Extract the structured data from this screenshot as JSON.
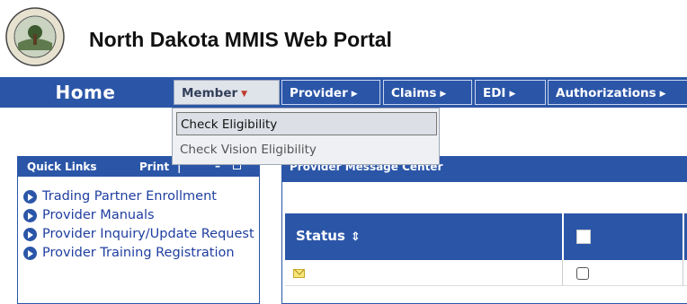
{
  "header": {
    "title": "North Dakota MMIS Web Portal"
  },
  "nav": {
    "home": "Home",
    "items": [
      {
        "label": "Member",
        "arrow": "▼",
        "state": "open"
      },
      {
        "label": "Provider",
        "arrow": "▶"
      },
      {
        "label": "Claims",
        "arrow": "▶"
      },
      {
        "label": "EDI",
        "arrow": "▶"
      },
      {
        "label": "Authorizations",
        "arrow": "▶"
      }
    ]
  },
  "member_menu": {
    "items": [
      {
        "label": "Check Eligibility",
        "state": "highlighted"
      },
      {
        "label": "Check Vision Eligibility",
        "state": "normal"
      }
    ]
  },
  "quick_links": {
    "title": "Quick Links",
    "print_label": "Print",
    "separator": "|",
    "minimize_glyph": "–",
    "items": [
      "Trading Partner Enrollment",
      "Provider Manuals",
      "Provider Inquiry/Update Request",
      "Provider Training Registration"
    ]
  },
  "message_center": {
    "title": "Provider Message Center",
    "columns": {
      "status": "Status",
      "sort_glyph": "⇕"
    },
    "rows": [
      {
        "status_icon": "envelope-icon",
        "checked": false
      }
    ]
  },
  "colors": {
    "nav_blue": "#2b56a8",
    "link_blue": "#1f3ea0",
    "menu_active_bg": "#dfe3ea"
  }
}
